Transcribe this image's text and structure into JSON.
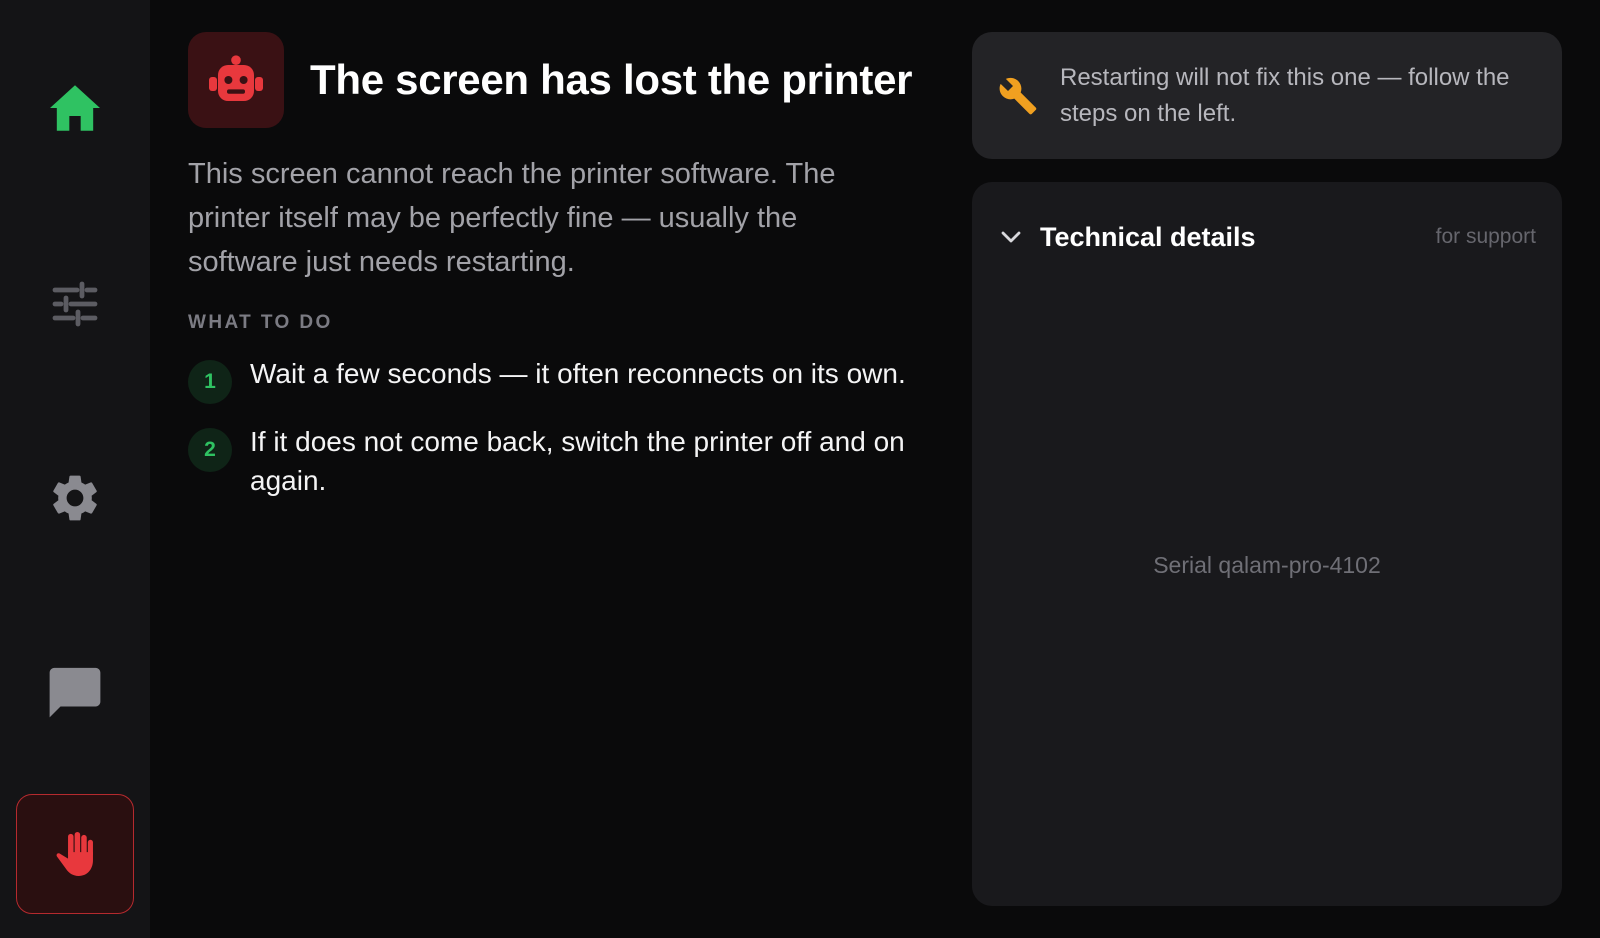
{
  "sidebar": {
    "items": [
      {
        "icon": "home-icon",
        "color": "#2fc262",
        "active": true
      },
      {
        "icon": "sliders-icon",
        "color": "#5c5c62",
        "active": false
      },
      {
        "icon": "gear-icon",
        "color": "#8a8a90",
        "active": false
      },
      {
        "icon": "chat-icon",
        "color": "#8a8a90",
        "active": false
      },
      {
        "icon": "hand-stop-icon",
        "color": "#e8383d",
        "active": false
      }
    ]
  },
  "main": {
    "icon": "robot-icon",
    "title": "The screen has lost the printer",
    "description": "This screen cannot reach the printer software. The printer itself may be perfectly fine — usually the software just needs restarting.",
    "section_label": "WHAT TO DO",
    "steps": [
      {
        "number": "1",
        "text": "Wait a few seconds — it often reconnects on its own."
      },
      {
        "number": "2",
        "text": "If it does not come back, switch the printer off and on again."
      }
    ]
  },
  "notice": {
    "icon": "wrench-icon",
    "text": "Restarting will not fix this one — follow the steps on the left."
  },
  "details": {
    "title": "Technical details",
    "hint": "for support",
    "serial": "Serial qalam-pro-4102"
  },
  "colors": {
    "accent_green": "#2fc262",
    "error_red": "#e8383d",
    "warning_amber": "#f0a020"
  }
}
